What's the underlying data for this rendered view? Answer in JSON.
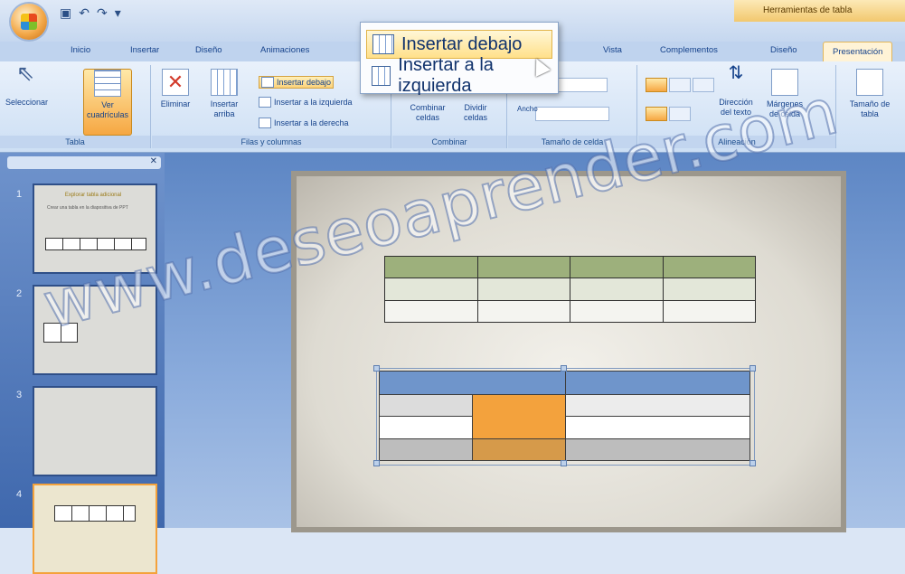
{
  "titlebar": {
    "context_tab_title": "Herramientas de tabla",
    "qat": [
      "save-icon",
      "undo-icon",
      "redo-icon",
      "customize-icon"
    ]
  },
  "tabs": [
    "Inicio",
    "Insertar",
    "Diseño",
    "Animaciones",
    "Vista",
    "Complementos",
    "Diseño",
    "Presentación"
  ],
  "ribbon": {
    "tabla": {
      "label": "Tabla",
      "seleccionar": "Seleccionar",
      "ver": "Ver cuadrículas"
    },
    "filas": {
      "label": "Filas y columnas",
      "eliminar": "Eliminar",
      "insertar_arriba": "Insertar arriba",
      "insertar_debajo": "Insertar debajo",
      "insertar_izq": "Insertar a la izquierda",
      "insertar_der": "Insertar a la derecha"
    },
    "combinar": {
      "label": "Combinar",
      "combinar_celdas": "Combinar celdas",
      "dividir_celdas": "Dividir celdas"
    },
    "tamano": {
      "label": "Tamaño de celda",
      "alto_label": "Alto",
      "ancho_label": "Ancho"
    },
    "alineacion": {
      "label": "Alineación",
      "direccion": "Dirección del texto",
      "margenes": "Márgenes de celda"
    },
    "tamano_tabla": {
      "label": "Tamaño de tabla"
    }
  },
  "popup": {
    "item1": "Insertar debajo",
    "item2": "Insertar a la izquierda"
  },
  "slides": {
    "count": [
      1,
      2,
      3,
      4
    ],
    "thumb1_title": "Explorar tabla adicional",
    "thumb1_sub": "Crear una tabla en la diapositiva de PPT"
  },
  "watermark": "www.deseoaprender.com",
  "colors": {
    "table1_header": "#9db07c",
    "table2_header": "#6f95cb",
    "orange_cell": "#f3a23d",
    "gray_row": "#bdbdbd"
  }
}
